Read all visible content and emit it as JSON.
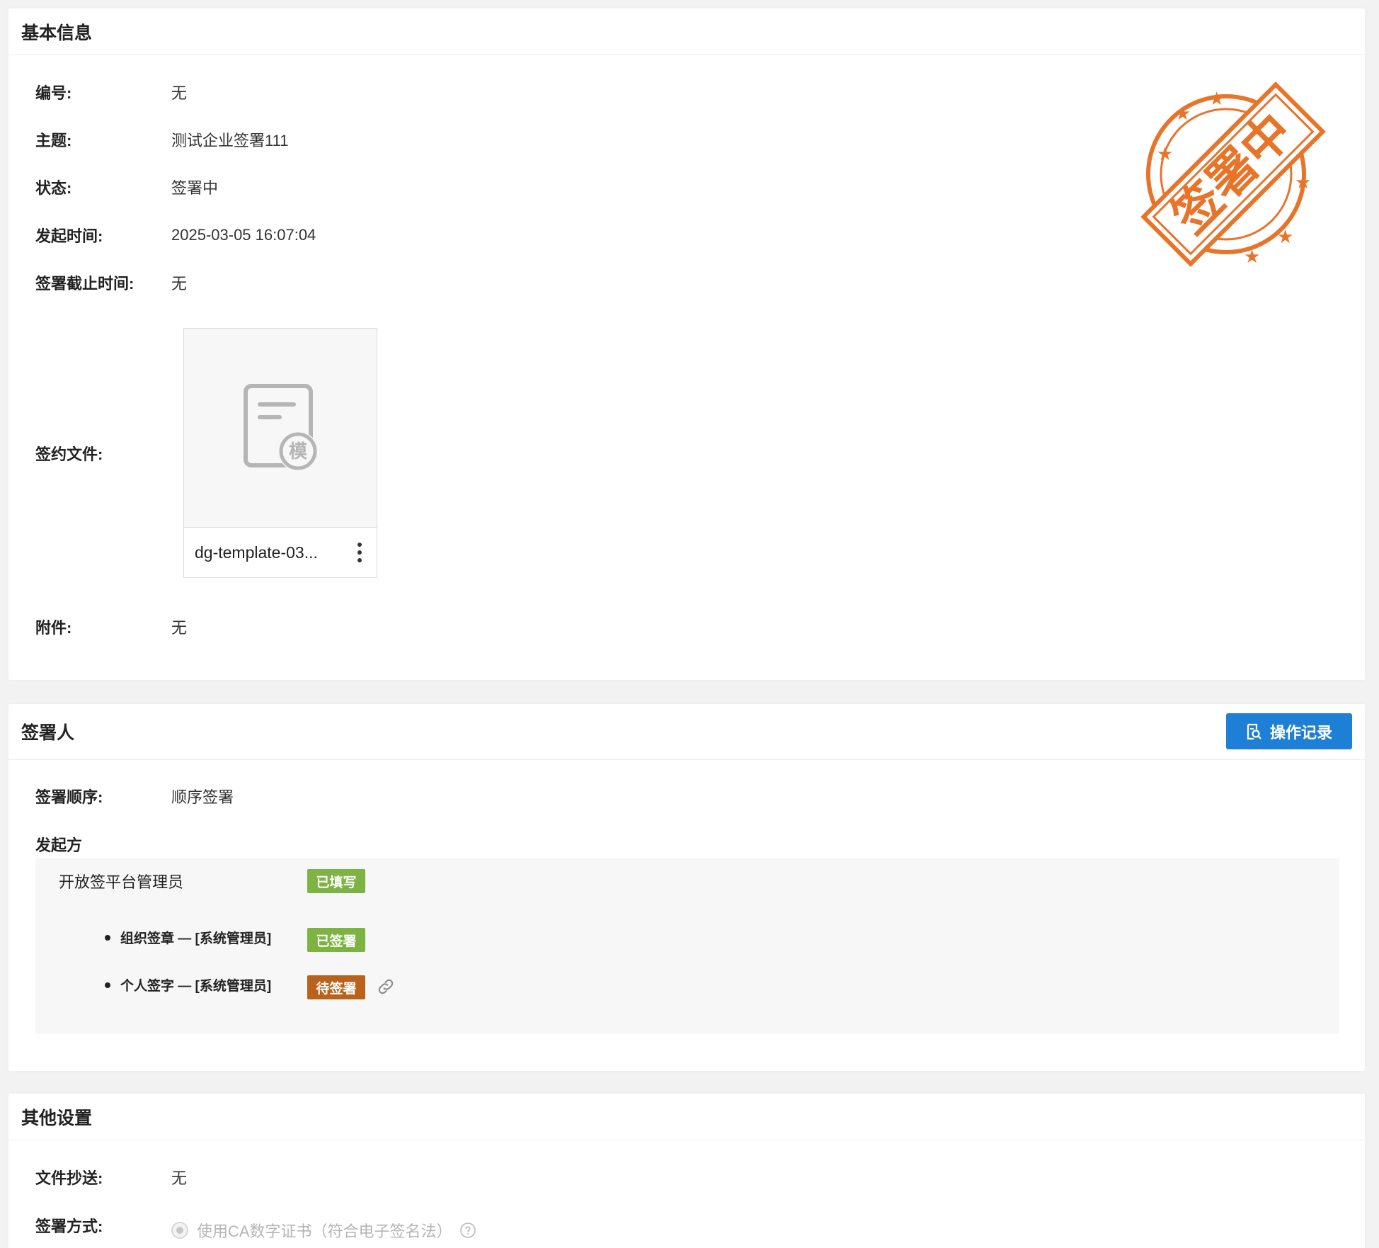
{
  "basic_info": {
    "title": "基本信息",
    "fields": [
      {
        "label": "编号:",
        "value": "无"
      },
      {
        "label": "主题:",
        "value": "测试企业签署111"
      },
      {
        "label": "状态:",
        "value": "签署中"
      },
      {
        "label": "发起时间:",
        "value": "2025-03-05 16:07:04"
      },
      {
        "label": "签署截止时间:",
        "value": "无"
      }
    ],
    "contract_file_label": "签约文件:",
    "file": {
      "name": "dg-template-03...",
      "badge_char": "模"
    },
    "attachment_label": "附件:",
    "attachment_value": "无",
    "stamp": {
      "text": "签署中",
      "color": "#e8742a"
    }
  },
  "signers": {
    "title": "签署人",
    "op_log_button": "操作记录",
    "order_label": "签署顺序:",
    "order_value": "顺序签署",
    "initiator_label": "发起方",
    "initiator": {
      "name": "开放签平台管理员",
      "status": "已填写",
      "items": [
        {
          "text": "组织签章 — [系统管理员]",
          "status": "已签署",
          "status_color": "#7cb342"
        },
        {
          "text": "个人签字 — [系统管理员]",
          "status": "待签署",
          "status_color": "#b8621b"
        }
      ]
    }
  },
  "other_settings": {
    "title": "其他设置",
    "cc_label": "文件抄送:",
    "cc_value": "无",
    "method_label": "签署方式:",
    "method_option": "使用CA数字证书（符合电子签名法）"
  },
  "colors": {
    "primary": "#1e7fd6",
    "green_tag": "#7cb342",
    "orange_tag": "#b8621b",
    "stamp": "#e8742a"
  }
}
